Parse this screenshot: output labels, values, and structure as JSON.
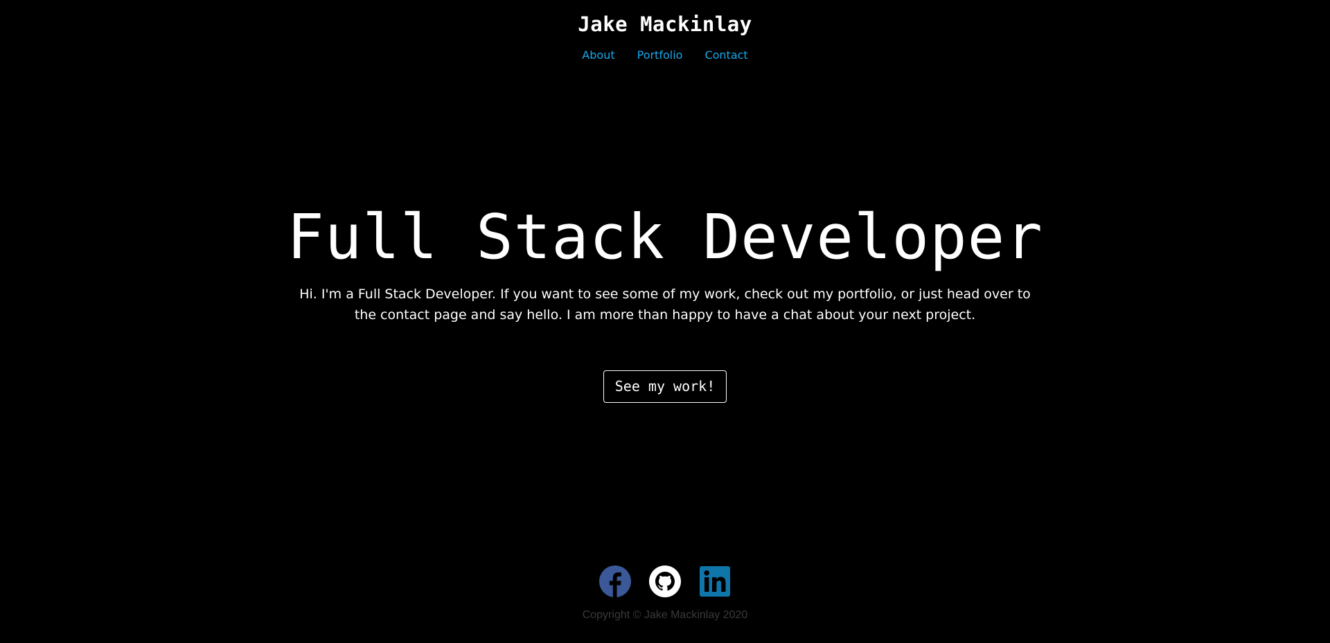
{
  "header": {
    "site_title": "Jake Mackinlay",
    "nav": [
      {
        "label": "About"
      },
      {
        "label": "Portfolio"
      },
      {
        "label": "Contact"
      }
    ]
  },
  "hero": {
    "title": "Full Stack Developer",
    "text": "Hi. I'm a Full Stack Developer. If you want to see some of my work, check out my portfolio, or just head over to the contact page and say hello. I am more than happy to have a chat about your next project.",
    "cta_label": "See my work!"
  },
  "footer": {
    "social": [
      {
        "icon": "facebook-icon",
        "color": "#3b5998"
      },
      {
        "icon": "github-icon",
        "color": "#ffffff"
      },
      {
        "icon": "linkedin-icon",
        "color": "#0e76a8"
      }
    ],
    "copyright": "Copyright © Jake Mackinlay 2020"
  },
  "colors": {
    "background": "#000000",
    "nav_link": "#17a9ec",
    "text": "#ffffff",
    "copyright": "#3a3a3a"
  }
}
